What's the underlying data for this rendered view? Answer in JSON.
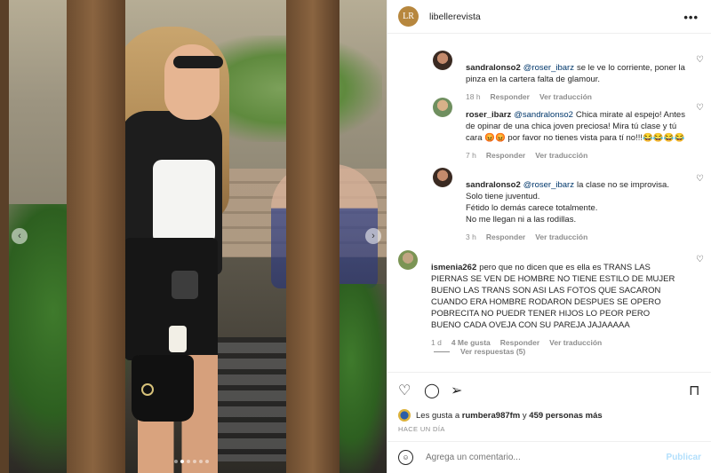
{
  "post": {
    "account": "libellerevista",
    "logo_text": "LR",
    "carousel": {
      "dots": 6,
      "active_dot": 1
    }
  },
  "comments": [
    {
      "user": "sandralonso2",
      "mention": "@roser_ibarz",
      "text": "se le ve lo corriente, poner la pinza en la cartera falta de glamour.",
      "time": "18 h",
      "reply": "Responder",
      "translate": "Ver traducción"
    },
    {
      "user": "roser_ibarz",
      "mention": "@sandralonso2",
      "text": "Chica mirate al espejo! Antes de opinar de una chica joven preciosa! Mira tú clase y tú cara 😡😡 por favor no tienes vista para tí no!!!😂😂😂😂",
      "time": "7 h",
      "reply": "Responder",
      "translate": "Ver traducción"
    },
    {
      "user": "sandralonso2",
      "mention": "@roser_ibarz",
      "text": "la clase no se improvisa.\nSolo tiene juventud.\nFétido lo demás carece totalmente.\nNo me llegan ni a las rodillas.",
      "time": "3 h",
      "reply": "Responder",
      "translate": "Ver traducción"
    },
    {
      "user": "ismenia262",
      "mention": "",
      "text": "pero que no dicen que es ella es TRANS LAS PIERNAS SE VEN DE HOMBRE NO TIENE ESTILO DE MUJER BUENO LAS TRANS SON ASI LAS FOTOS QUE SACARON CUANDO ERA HOMBRE RODARON DESPUES SE OPERO POBRECITA NO PUEDR TENER HIJOS LO PEOR PERO BUENO CADA OVEJA CON SU PAREJA JAJAAAAA",
      "time": "1 d",
      "likes": "4 Me gusta",
      "reply": "Responder",
      "translate": "Ver traducción"
    }
  ],
  "view_replies": "Ver respuestas (5)",
  "likes": {
    "prefix": "Les gusta a",
    "first_user": "rumbera987fm",
    "joiner": "y",
    "others": "459 personas más"
  },
  "posted_ago": "HACE UN DÍA",
  "add_comment": {
    "placeholder": "Agrega un comentario...",
    "publish": "Publicar"
  }
}
